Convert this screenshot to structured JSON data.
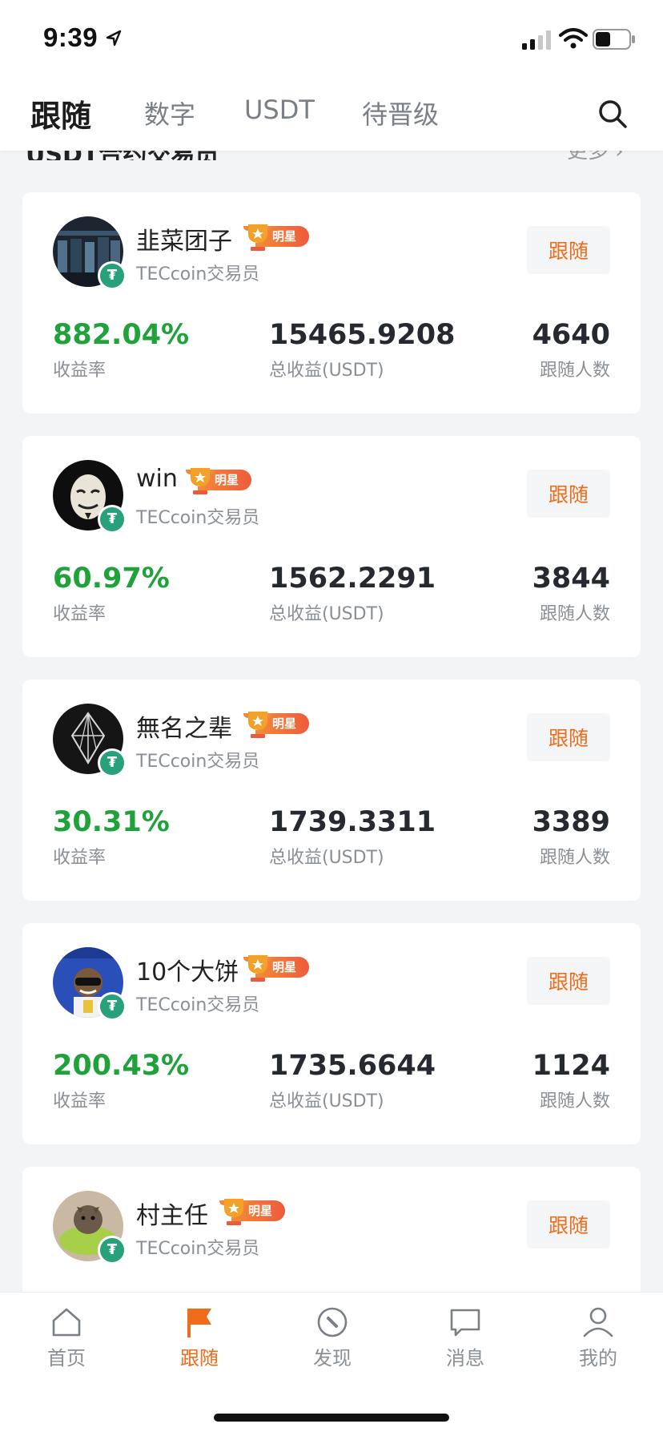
{
  "status_bar": {
    "time": "9:39"
  },
  "nav": {
    "tabs": [
      {
        "label": "跟随",
        "active": true
      },
      {
        "label": "数字",
        "active": false
      },
      {
        "label": "USDT",
        "active": false
      },
      {
        "label": "待晋级",
        "active": false
      }
    ]
  },
  "section": {
    "title": "USDT合约交易员",
    "more": "更多 ›"
  },
  "traders": [
    {
      "name": "韭菜团子",
      "badge": "明星",
      "role": "TECcoin交易员",
      "follow": "跟随",
      "rate": "882.04%",
      "rate_label": "收益率",
      "profit": "15465.9208",
      "profit_label": "总收益(USDT)",
      "followers": "4640",
      "followers_label": "跟随人数"
    },
    {
      "name": "win",
      "badge": "明星",
      "role": "TECcoin交易员",
      "follow": "跟随",
      "rate": "60.97%",
      "rate_label": "收益率",
      "profit": "1562.2291",
      "profit_label": "总收益(USDT)",
      "followers": "3844",
      "followers_label": "跟随人数"
    },
    {
      "name": "無名之辈",
      "badge": "明星",
      "role": "TECcoin交易员",
      "follow": "跟随",
      "rate": "30.31%",
      "rate_label": "收益率",
      "profit": "1739.3311",
      "profit_label": "总收益(USDT)",
      "followers": "3389",
      "followers_label": "跟随人数"
    },
    {
      "name": "10个大饼",
      "badge": "明星",
      "role": "TECcoin交易员",
      "follow": "跟随",
      "rate": "200.43%",
      "rate_label": "收益率",
      "profit": "1735.6644",
      "profit_label": "总收益(USDT)",
      "followers": "1124",
      "followers_label": "跟随人数"
    },
    {
      "name": "村主任",
      "badge": "明星",
      "role": "TECcoin交易员",
      "follow": "跟随"
    }
  ],
  "coin_symbol": "₮",
  "tab_bar": {
    "items": [
      {
        "label": "首页",
        "icon": "home-icon"
      },
      {
        "label": "跟随",
        "icon": "flag-icon",
        "active": true
      },
      {
        "label": "发现",
        "icon": "compass-icon"
      },
      {
        "label": "消息",
        "icon": "chat-icon"
      },
      {
        "label": "我的",
        "icon": "user-icon"
      }
    ]
  },
  "colors": {
    "accent": "#ef6c1a",
    "positive": "#1fa23a",
    "tether": "#26a17b"
  }
}
